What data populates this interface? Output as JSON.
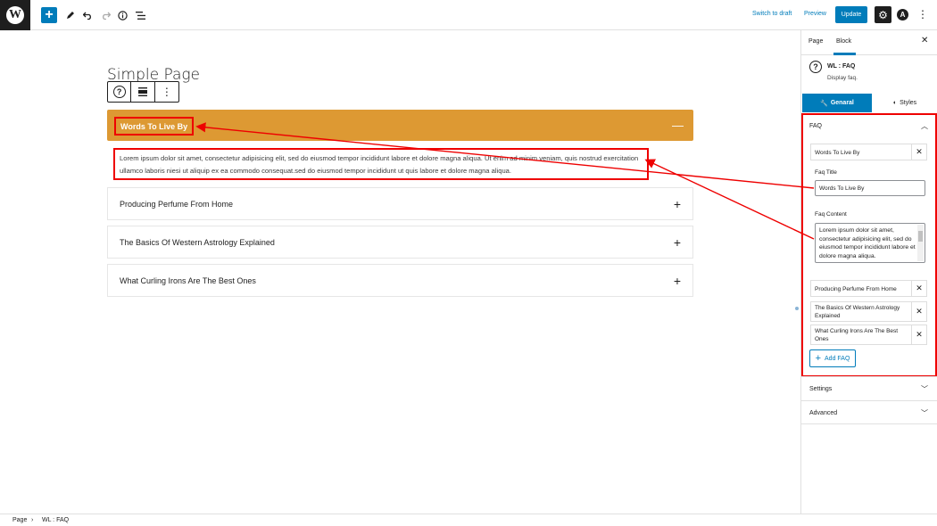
{
  "topbar": {
    "add_block_icon": "plus-icon",
    "tools_icon": "pencil-icon",
    "undo_icon": "undo-icon",
    "redo_icon": "redo-icon",
    "details_icon": "info-icon",
    "list_view_icon": "list-view-icon",
    "switch_to_draft": "Switch to draft",
    "preview": "Preview",
    "update": "Update",
    "settings_icon": "gear-icon",
    "more_icon": "vertical-ellipsis-icon"
  },
  "editor": {
    "page_title": "Simple Page",
    "faq_open": {
      "title": "Words To Live By",
      "content": "Lorem ipsum dolor sit amet, consectetur adipisicing elit, sed do eiusmod tempor incididunt labore et dolore magna aliqua. Ut enim ad minim veniam, quis nostrud exercitation ullamco laboris niesi ut aliquip ex ea commodo consequat.sed do eiusmod tempor incididunt ut quis labore et dolore magna aliqua."
    },
    "faq_items": [
      {
        "title": "Producing Perfume From Home"
      },
      {
        "title": "The Basics Of Western Astrology Explained"
      },
      {
        "title": "What Curling Irons Are The Best Ones"
      }
    ]
  },
  "sidebar": {
    "tabs": [
      "Page",
      "Block"
    ],
    "active_tab": "Block",
    "block_name": "WL : FAQ",
    "block_description": "Display faq.",
    "panel_tabs": [
      "Genaral",
      "Styles"
    ],
    "faq_panel": {
      "title": "FAQ",
      "rows": [
        {
          "label": "Words To Live By"
        },
        {
          "label": "Producing Perfume From Home"
        },
        {
          "label": "The Basics Of Western Astrology Explained"
        },
        {
          "label": "What Curling Irons Are The Best Ones"
        }
      ],
      "faq_title_label": "Faq Title",
      "faq_title_value": "Words To Live By",
      "faq_content_label": "Faq Content",
      "faq_content_value": "Lorem ipsum dolor sit amet, consectetur adipisicing elit, sed do eiusmod tempor incididunt labore et dolore magna aliqua.",
      "add_button": "Add FAQ"
    },
    "sections": [
      "Settings",
      "Advanced"
    ]
  },
  "footer": {
    "breadcrumb": [
      "Page",
      "WL : FAQ"
    ]
  },
  "colors": {
    "accent": "#007cba",
    "faq_header": "#dd9933",
    "annotation": "#ee0000"
  }
}
